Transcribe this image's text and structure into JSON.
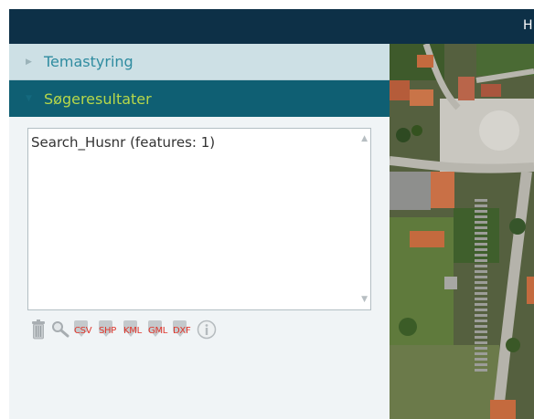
{
  "header": {
    "title": "H"
  },
  "accordion": {
    "items": [
      {
        "label": "Temastyring",
        "expanded": false
      },
      {
        "label": "Søgeresultater",
        "expanded": true
      }
    ]
  },
  "results": {
    "items": [
      {
        "label": "Search_Husnr (features: 1)"
      }
    ]
  },
  "toolbar": {
    "icons": [
      "trash-icon",
      "zoom-icon",
      "download-icon",
      "info-icon"
    ],
    "downloads": [
      {
        "format": "CSV"
      },
      {
        "format": "SHP"
      },
      {
        "format": "KML"
      },
      {
        "format": "GML"
      },
      {
        "format": "DXF"
      }
    ]
  },
  "colors": {
    "header_bg": "#0d3047",
    "accordion_collapsed_bg": "#cde0e5",
    "accordion_collapsed_text": "#2f8ca0",
    "accordion_active_bg": "#0f5f73",
    "accordion_active_text": "#b6d74a",
    "panel_bg": "#f0f4f6",
    "download_label": "#e0362c"
  }
}
